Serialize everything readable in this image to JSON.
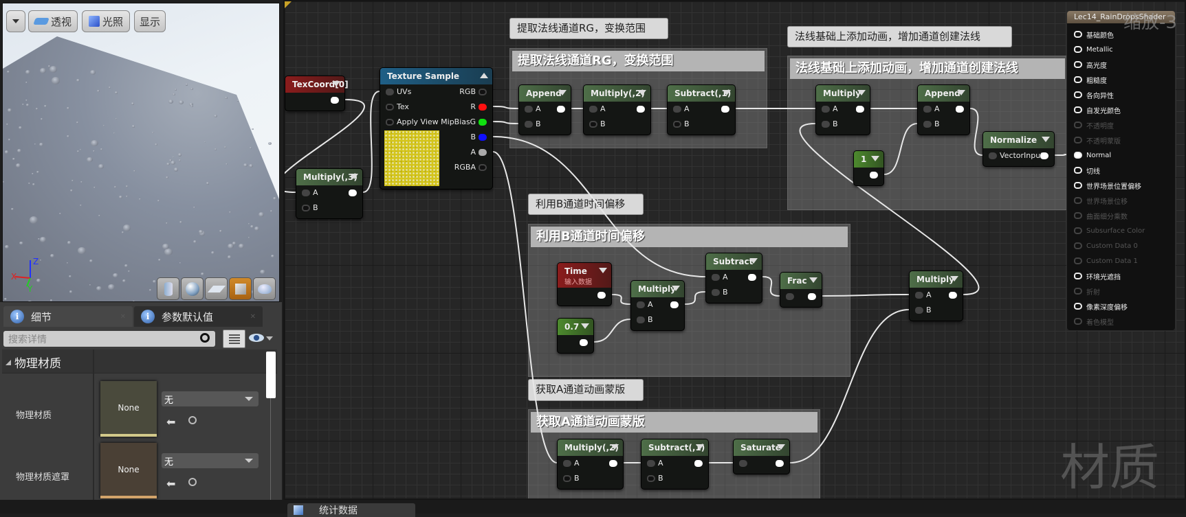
{
  "viewport": {
    "toolbar": {
      "menu_icon": "chevron-down-icon",
      "perspective": "透视",
      "lighting": "光照",
      "show": "显示"
    },
    "axes": {
      "x": "X",
      "y": "Y",
      "z": "Z"
    },
    "preview_shapes": [
      "cylinder",
      "sphere",
      "plane",
      "cube",
      "teapot"
    ],
    "active_shape": "cube"
  },
  "details": {
    "tabs": [
      {
        "label": "细节"
      },
      {
        "label": "参数默认值"
      }
    ],
    "search_placeholder": "搜索详情",
    "section": "物理材质",
    "properties": [
      {
        "label": "物理材质",
        "thumb": "None",
        "value": "无",
        "thumb_color": "#4a4a3c",
        "bar_color": "#d2c98a"
      },
      {
        "label": "物理材质遮罩",
        "thumb": "None",
        "value": "无",
        "thumb_color": "#4a4035",
        "bar_color": "#d3a46a"
      }
    ]
  },
  "graph": {
    "zoom_label": "缩放-3",
    "watermark": "材质",
    "comments": [
      {
        "bubble": "提取法线通道RG，变换范围",
        "title": "提取法线通道RG，变换范围"
      },
      {
        "bubble": "法线基础上添加动画，增加通道创建法线",
        "title": "法线基础上添加动画，增加通道创建法线"
      },
      {
        "bubble": "利用B通道时间偏移",
        "title": "利用B通道时间偏移"
      },
      {
        "bubble": "获取A通道动画蒙版",
        "title": "获取A通道动画蒙版"
      }
    ],
    "nodes": [
      {
        "id": "texcoord",
        "title": "TexCoord[0]",
        "kind": "input",
        "inputs": [],
        "outputs": [
          ""
        ]
      },
      {
        "id": "mul3",
        "title": "Multiply(,3)",
        "kind": "math",
        "inputs": [
          "A",
          "B"
        ],
        "outputs": [
          ""
        ]
      },
      {
        "id": "tex",
        "title": "Texture Sample",
        "kind": "texture",
        "inputs": [
          "UVs",
          "Tex",
          "Apply View MipBias"
        ],
        "outputs": [
          "RGB",
          "R",
          "G",
          "B",
          "A",
          "RGBA"
        ],
        "output_colors": [
          "",
          "#ff1010",
          "#10e010",
          "#1010ff",
          "#aaaaaa",
          ""
        ]
      },
      {
        "id": "append1",
        "title": "Append",
        "kind": "math",
        "inputs": [
          "A",
          "B"
        ],
        "outputs": [
          ""
        ]
      },
      {
        "id": "mul2",
        "title": "Multiply(,2)",
        "kind": "math",
        "inputs": [
          "A",
          "B"
        ],
        "outputs": [
          ""
        ]
      },
      {
        "id": "sub1",
        "title": "Subtract(,1)",
        "kind": "math",
        "inputs": [
          "A",
          "B"
        ],
        "outputs": [
          ""
        ]
      },
      {
        "id": "multop",
        "title": "Multiply",
        "kind": "math",
        "inputs": [
          "A",
          "B"
        ],
        "outputs": [
          ""
        ]
      },
      {
        "id": "appendtop",
        "title": "Append",
        "kind": "math",
        "inputs": [
          "A",
          "B"
        ],
        "outputs": [
          ""
        ]
      },
      {
        "id": "one",
        "title": "1",
        "kind": "constant",
        "inputs": [],
        "outputs": [
          ""
        ]
      },
      {
        "id": "normalize",
        "title": "Normalize",
        "kind": "math",
        "inputs": [
          "VectorInput"
        ],
        "outputs": [
          ""
        ]
      },
      {
        "id": "time",
        "title": "Time",
        "subtitle": "输入数据",
        "kind": "input",
        "inputs": [],
        "outputs": [
          ""
        ]
      },
      {
        "id": "c07",
        "title": "0.7",
        "kind": "constant",
        "inputs": [],
        "outputs": [
          ""
        ]
      },
      {
        "id": "mulmid",
        "title": "Multiply",
        "kind": "math",
        "inputs": [
          "A",
          "B"
        ],
        "outputs": [
          ""
        ]
      },
      {
        "id": "sub",
        "title": "Subtract",
        "kind": "math",
        "inputs": [
          "A",
          "B"
        ],
        "outputs": [
          ""
        ]
      },
      {
        "id": "frac",
        "title": "Frac",
        "kind": "math",
        "inputs": [
          ""
        ],
        "outputs": [
          ""
        ]
      },
      {
        "id": "mulright",
        "title": "Multiply",
        "kind": "math",
        "inputs": [
          "A",
          "B"
        ],
        "outputs": [
          ""
        ]
      },
      {
        "id": "mul2b",
        "title": "Multiply(,2)",
        "kind": "math",
        "inputs": [
          "A",
          "B"
        ],
        "outputs": [
          ""
        ]
      },
      {
        "id": "sub1b",
        "title": "Subtract(,1)",
        "kind": "math",
        "inputs": [
          "A",
          "B"
        ],
        "outputs": [
          ""
        ]
      },
      {
        "id": "saturate",
        "title": "Saturate",
        "kind": "math",
        "inputs": [
          ""
        ],
        "outputs": [
          ""
        ]
      }
    ],
    "result": {
      "title": "Lec14_RainDropsShader",
      "pins": [
        {
          "label": "基础颜色",
          "enabled": true
        },
        {
          "label": "Metallic",
          "enabled": true
        },
        {
          "label": "高光度",
          "enabled": true
        },
        {
          "label": "粗糙度",
          "enabled": true
        },
        {
          "label": "各向异性",
          "enabled": true
        },
        {
          "label": "自发光颜色",
          "enabled": true
        },
        {
          "label": "不透明度",
          "enabled": false
        },
        {
          "label": "不透明蒙版",
          "enabled": false
        },
        {
          "label": "Normal",
          "enabled": true,
          "connected": true
        },
        {
          "label": "切线",
          "enabled": true
        },
        {
          "label": "世界场景位置偏移",
          "enabled": true
        },
        {
          "label": "世界场景位移",
          "enabled": false
        },
        {
          "label": "曲面细分乘数",
          "enabled": false
        },
        {
          "label": "Subsurface Color",
          "enabled": false
        },
        {
          "label": "Custom Data 0",
          "enabled": false
        },
        {
          "label": "Custom Data 1",
          "enabled": false
        },
        {
          "label": "环境光遮挡",
          "enabled": true
        },
        {
          "label": "折射",
          "enabled": false
        },
        {
          "label": "像素深度偏移",
          "enabled": true
        },
        {
          "label": "着色模型",
          "enabled": false
        }
      ]
    },
    "colors": {
      "math_header": "#4e6e48",
      "input_header": "#8a1c1c",
      "texture_header": "#1f5f86",
      "constant_header": "#4d8a2e",
      "result_header": "#7a6a56"
    }
  },
  "bottom_tab": "统计数据"
}
